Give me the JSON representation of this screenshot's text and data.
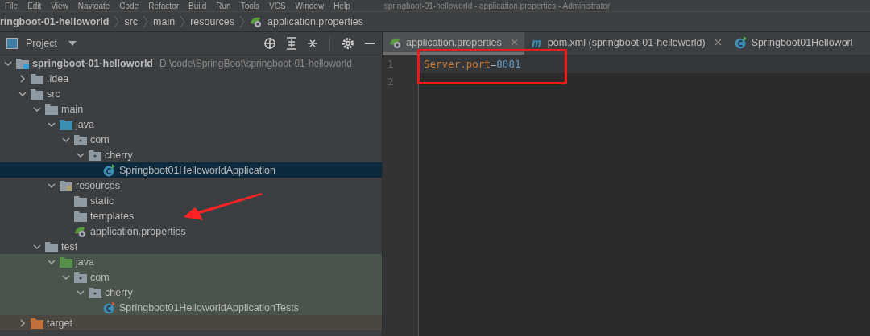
{
  "menu": [
    "File",
    "Edit",
    "View",
    "Navigate",
    "Code",
    "Refactor",
    "Build",
    "Run",
    "Tools",
    "VCS",
    "Window",
    "Help"
  ],
  "window": {
    "title": "springboot-01-helloworld - application.properties - Administrator"
  },
  "breadcrumb": [
    {
      "label": "ringboot-01-helloworld",
      "kind": "project"
    },
    {
      "label": "src",
      "kind": "folder"
    },
    {
      "label": "main",
      "kind": "folder"
    },
    {
      "label": "resources",
      "kind": "folder"
    },
    {
      "label": "application.properties",
      "kind": "spring"
    }
  ],
  "project_panel": {
    "title": "Project"
  },
  "tree": [
    {
      "label": "springboot-01-helloworld",
      "path": "D:\\code\\SpringBoot\\springboot-01-helloworld",
      "kind": "module",
      "expanded": true,
      "selected": false,
      "children": [
        {
          "label": ".idea",
          "kind": "folder",
          "expanded": false,
          "selected": false
        },
        {
          "label": "src",
          "kind": "folder",
          "expanded": true,
          "selected": false,
          "children": [
            {
              "label": "main",
              "kind": "folder",
              "expanded": true,
              "selected": false,
              "children": [
                {
                  "label": "java",
                  "kind": "source",
                  "expanded": true,
                  "selected": false,
                  "children": [
                    {
                      "label": "com",
                      "kind": "package",
                      "expanded": true,
                      "selected": false,
                      "children": [
                        {
                          "label": "cherry",
                          "kind": "package",
                          "expanded": true,
                          "selected": false,
                          "children": [
                            {
                              "label": "Springboot01HelloworldApplication",
                              "kind": "spring_class",
                              "selected": true
                            }
                          ]
                        }
                      ]
                    }
                  ]
                },
                {
                  "label": "resources",
                  "kind": "resources",
                  "expanded": true,
                  "selected": false,
                  "children": [
                    {
                      "label": "static",
                      "kind": "folder",
                      "selected": false
                    },
                    {
                      "label": "templates",
                      "kind": "folder",
                      "selected": false
                    },
                    {
                      "label": "application.properties",
                      "kind": "spring",
                      "selected": false
                    }
                  ]
                }
              ]
            },
            {
              "label": "test",
              "kind": "folder",
              "expanded": true,
              "selected": false,
              "children": [
                {
                  "label": "java",
                  "kind": "test_source",
                  "color": "#49544a",
                  "expanded": true,
                  "selected": false,
                  "children": [
                    {
                      "label": "com",
                      "kind": "package",
                      "color": "#49544a",
                      "expanded": true,
                      "selected": false,
                      "children": [
                        {
                          "label": "cherry",
                          "kind": "package",
                          "color": "#49544a",
                          "expanded": true,
                          "selected": false,
                          "children": [
                            {
                              "label": "Springboot01HelloworldApplicationTests",
                              "kind": "test_class",
                              "color": "#49544a",
                              "selected": false
                            }
                          ]
                        }
                      ]
                    }
                  ]
                }
              ]
            }
          ]
        },
        {
          "label": "target",
          "kind": "excluded",
          "color": "#4b4740",
          "expanded": false,
          "selected": false
        }
      ]
    }
  ],
  "tabs": [
    {
      "label": "application.properties",
      "kind": "spring",
      "selected": true,
      "closable": true
    },
    {
      "label": "pom.xml (springboot-01-helloworld)",
      "kind": "maven",
      "selected": false,
      "closable": true
    },
    {
      "label": "Springboot01Helloworl",
      "kind": "spring_class",
      "selected": false,
      "closable": false
    }
  ],
  "editor": {
    "lines": [
      {
        "number": "1",
        "current": true,
        "tokens": [
          {
            "text": "Server.port",
            "kind": "key"
          },
          {
            "text": "=",
            "kind": "op"
          },
          {
            "text": "8081",
            "kind": "value"
          }
        ]
      },
      {
        "number": "2",
        "current": false
      }
    ]
  }
}
